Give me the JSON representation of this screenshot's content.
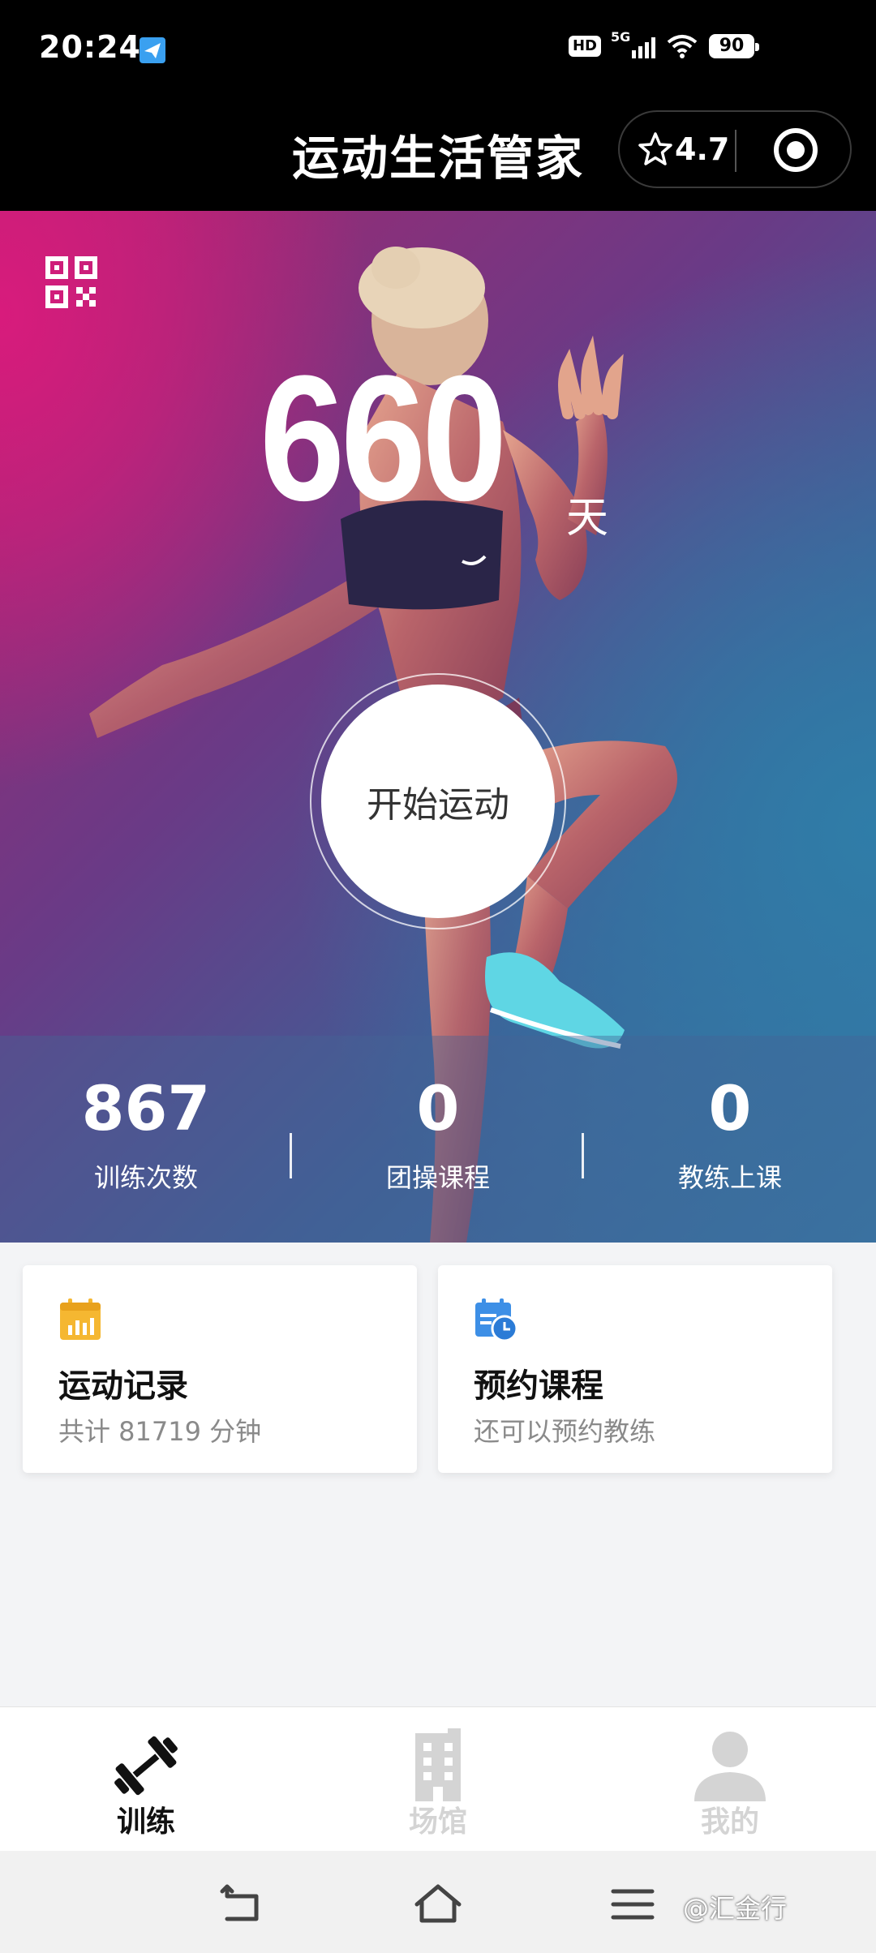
{
  "status_bar": {
    "time": "20:24",
    "battery": "90",
    "signal_label": "5G",
    "hd_badge": "HD"
  },
  "header": {
    "title": "运动生活管家",
    "rating": "4.7"
  },
  "hero": {
    "days_value": "660",
    "days_unit": "天",
    "start_button_label": "开始运动",
    "stats": [
      {
        "value": "867",
        "label": "训练次数"
      },
      {
        "value": "0",
        "label": "团操课程"
      },
      {
        "value": "0",
        "label": "教练上课"
      }
    ]
  },
  "cards": {
    "record": {
      "title": "运动记录",
      "subtitle": "共计 81719 分钟",
      "icon_color": "#f5b731"
    },
    "booking": {
      "title": "预约课程",
      "subtitle": "还可以预约教练",
      "icon_color": "#3d8fe6"
    }
  },
  "bottom_nav": {
    "items": [
      {
        "label": "训练",
        "active": true
      },
      {
        "label": "场馆",
        "active": false
      },
      {
        "label": "我的",
        "active": false
      }
    ],
    "active_color": "#111111",
    "inactive_color": "#d4d4d4"
  },
  "watermark": "@汇金行"
}
